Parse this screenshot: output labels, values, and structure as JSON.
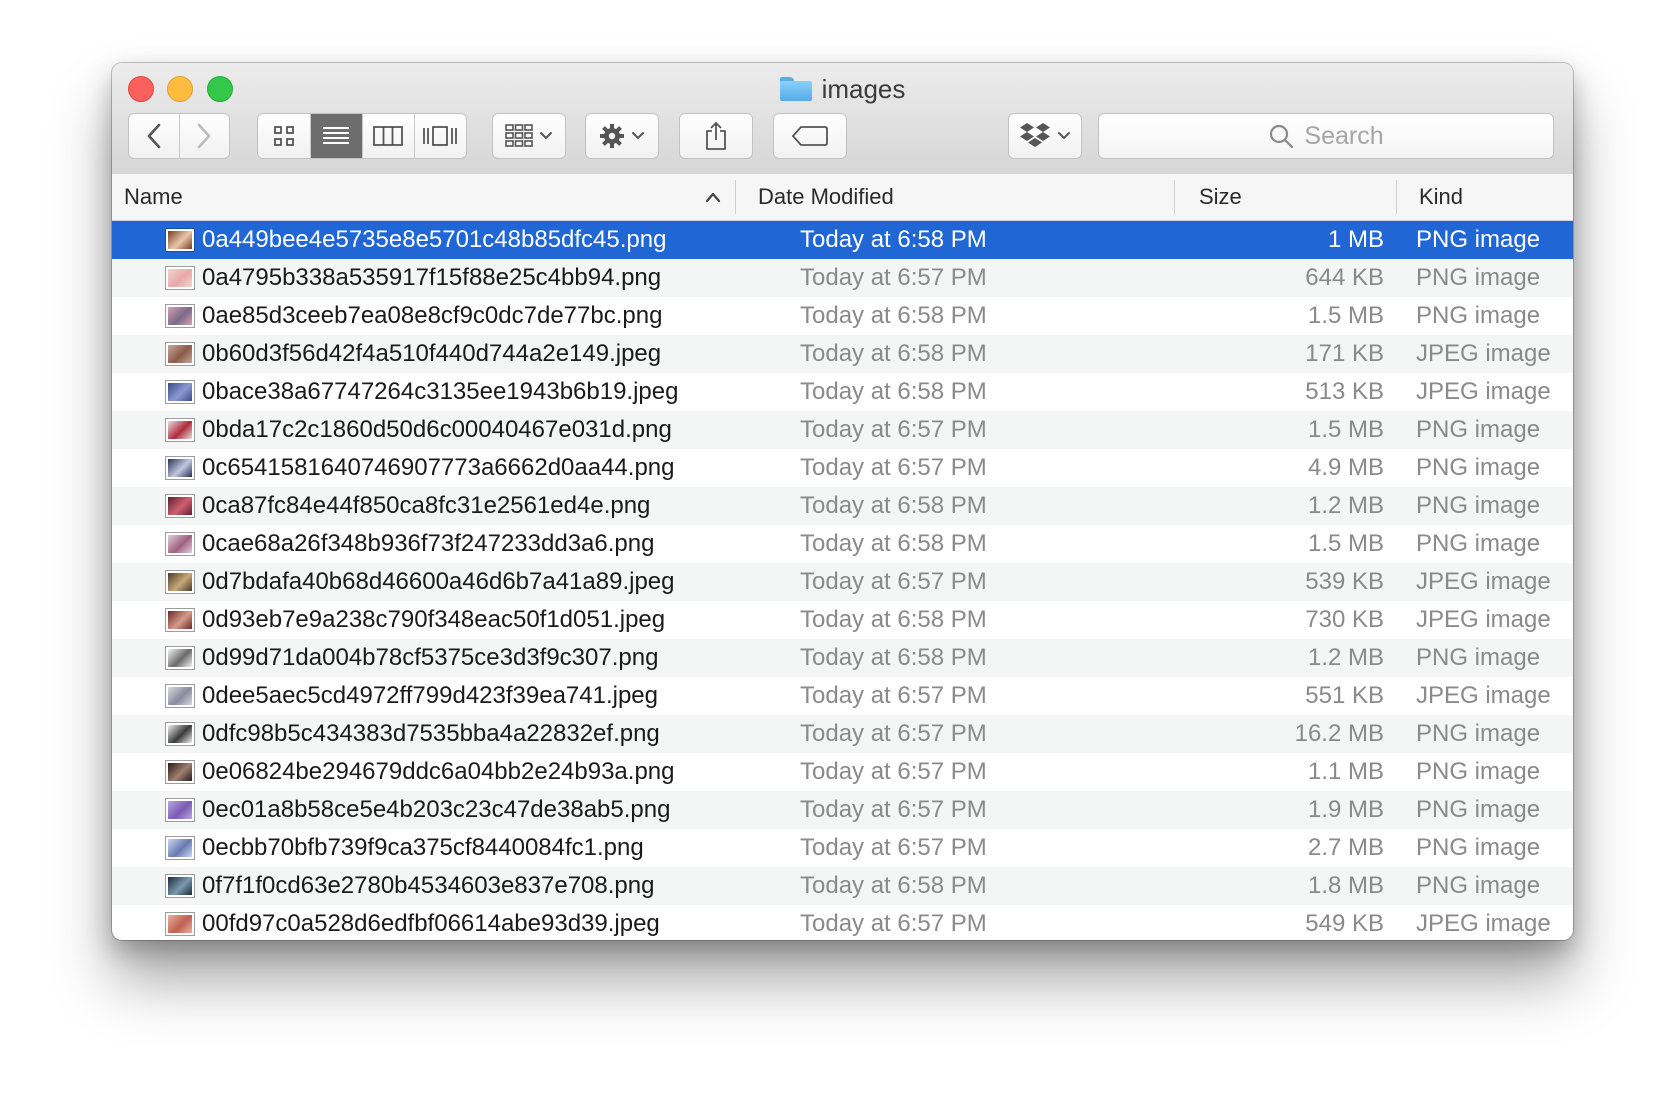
{
  "window": {
    "title": "images"
  },
  "toolbar": {
    "search_placeholder": "Search",
    "icons": {
      "back": "chevron-left-icon",
      "forward": "chevron-right-icon",
      "icon_view": "grid-icon",
      "list_view": "list-icon",
      "column_view": "columns-icon",
      "coverflow_view": "coverflow-icon",
      "arrange": "arrange-icon",
      "action": "gear-icon",
      "share": "share-icon",
      "tags": "tag-icon",
      "dropbox": "dropbox-icon",
      "search": "search-icon"
    },
    "active_view": "list"
  },
  "columns": {
    "name": "Name",
    "date": "Date Modified",
    "size": "Size",
    "kind": "Kind",
    "sort_indicator": "chevron-up-icon"
  },
  "colors": {
    "selection": "#2166d5",
    "close": "#fc605c",
    "minimize": "#fdbc40",
    "maximize": "#34c84a",
    "folder": "#6bbcf2"
  },
  "files": [
    {
      "name": "0a449bee4e5735e8e5701c48b85dfc45.png",
      "date": "Today at 6:58 PM",
      "size": "1 MB",
      "kind": "PNG image",
      "selected": true,
      "thumb": [
        "#7a3a2a",
        "#e8c9a8"
      ]
    },
    {
      "name": "0a4795b338a535917f15f88e25c4bb94.png",
      "date": "Today at 6:57 PM",
      "size": "644 KB",
      "kind": "PNG image",
      "thumb": [
        "#f0d6d0",
        "#e8a8a8"
      ]
    },
    {
      "name": "0ae85d3ceeb7ea08e8cf9c0dc7de77bc.png",
      "date": "Today at 6:58 PM",
      "size": "1.5 MB",
      "kind": "PNG image",
      "thumb": [
        "#d7a0b0",
        "#7a6a8a"
      ]
    },
    {
      "name": "0b60d3f56d42f4a510f440d744a2e149.jpeg",
      "date": "Today at 6:58 PM",
      "size": "171 KB",
      "kind": "JPEG image",
      "thumb": [
        "#c9a89a",
        "#8a5a4a"
      ]
    },
    {
      "name": "0bace38a67747264c3135ee1943b6b19.jpeg",
      "date": "Today at 6:58 PM",
      "size": "513 KB",
      "kind": "JPEG image",
      "thumb": [
        "#3a4a8a",
        "#8a9ad0"
      ]
    },
    {
      "name": "0bda17c2c1860d50d6c00040467e031d.png",
      "date": "Today at 6:57 PM",
      "size": "1.5 MB",
      "kind": "PNG image",
      "thumb": [
        "#e8e0e0",
        "#b02a3a"
      ]
    },
    {
      "name": "0c6541581640746907773a6662d0aa44.png",
      "date": "Today at 6:57 PM",
      "size": "4.9 MB",
      "kind": "PNG image",
      "thumb": [
        "#2a3050",
        "#c0c8e0"
      ]
    },
    {
      "name": "0ca87fc84e44f850ca8fc31e2561ed4e.png",
      "date": "Today at 6:58 PM",
      "size": "1.2 MB",
      "kind": "PNG image",
      "thumb": [
        "#5a2030",
        "#d06070"
      ]
    },
    {
      "name": "0cae68a26f348b936f73f247233dd3a6.png",
      "date": "Today at 6:58 PM",
      "size": "1.5 MB",
      "kind": "PNG image",
      "thumb": [
        "#e0d0d8",
        "#a06080"
      ]
    },
    {
      "name": "0d7bdafa40b68d46600a46d6b7a41a89.jpeg",
      "date": "Today at 6:57 PM",
      "size": "539 KB",
      "kind": "JPEG image",
      "thumb": [
        "#4a3a2a",
        "#c8a878"
      ]
    },
    {
      "name": "0d93eb7e9a238c790f348eac50f1d051.jpeg",
      "date": "Today at 6:58 PM",
      "size": "730 KB",
      "kind": "JPEG image",
      "thumb": [
        "#6a2a2a",
        "#d89a8a"
      ]
    },
    {
      "name": "0d99d71da004b78cf5375ce3d3f9c307.png",
      "date": "Today at 6:58 PM",
      "size": "1.2 MB",
      "kind": "PNG image",
      "thumb": [
        "#f4f4f4",
        "#6a6a6a"
      ]
    },
    {
      "name": "0dee5aec5cd4972ff799d423f39ea741.jpeg",
      "date": "Today at 6:57 PM",
      "size": "551 KB",
      "kind": "JPEG image",
      "thumb": [
        "#d8d8e0",
        "#8a8aa0"
      ]
    },
    {
      "name": "0dfc98b5c434383d7535bba4a22832ef.png",
      "date": "Today at 6:57 PM",
      "size": "16.2 MB",
      "kind": "PNG image",
      "thumb": [
        "#f0f0f0",
        "#3a3a3a"
      ]
    },
    {
      "name": "0e06824be294679ddc6a04bb2e24b93a.png",
      "date": "Today at 6:57 PM",
      "size": "1.1 MB",
      "kind": "PNG image",
      "thumb": [
        "#2a1a1a",
        "#a08070"
      ]
    },
    {
      "name": "0ec01a8b58ce5e4b203c23c47de38ab5.png",
      "date": "Today at 6:57 PM",
      "size": "1.9 MB",
      "kind": "PNG image",
      "thumb": [
        "#b8a8e0",
        "#7a5ab0"
      ]
    },
    {
      "name": "0ecbb70bfb739f9ca375cf8440084fc1.png",
      "date": "Today at 6:57 PM",
      "size": "2.7 MB",
      "kind": "PNG image",
      "thumb": [
        "#c8d8f0",
        "#6a7ab0"
      ]
    },
    {
      "name": "0f7f1f0cd63e2780b4534603e837e708.png",
      "date": "Today at 6:58 PM",
      "size": "1.8 MB",
      "kind": "PNG image",
      "thumb": [
        "#1a2a3a",
        "#7a9ab0"
      ]
    },
    {
      "name": "00fd97c0a528d6edfbf06614abe93d39.jpeg",
      "date": "Today at 6:57 PM",
      "size": "549 KB",
      "kind": "JPEG image",
      "thumb": [
        "#e8b0a0",
        "#c06050"
      ]
    }
  ]
}
